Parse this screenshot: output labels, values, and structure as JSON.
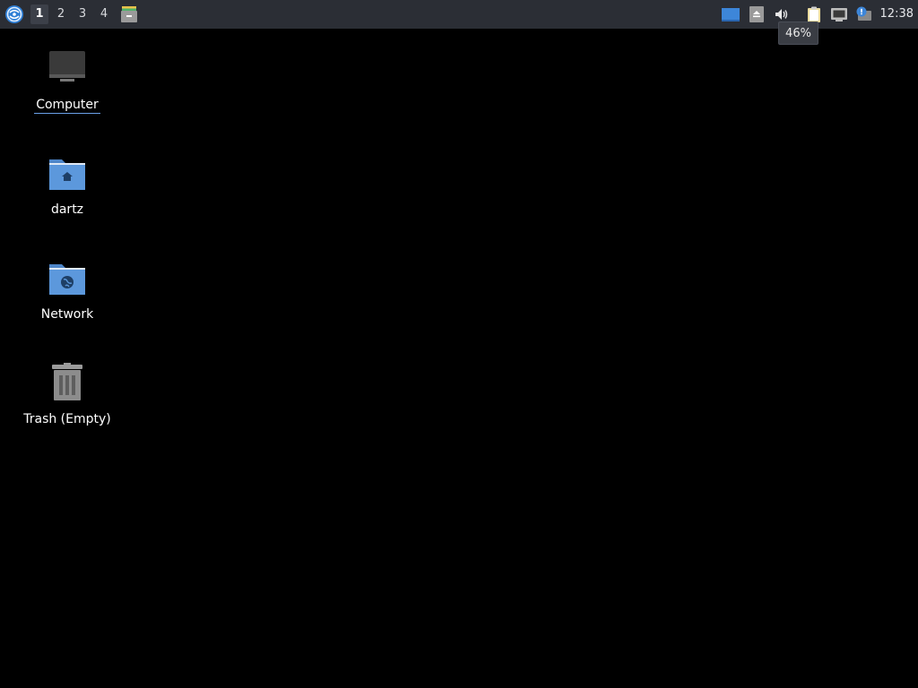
{
  "panel": {
    "workspaces": [
      {
        "label": "1",
        "active": true
      },
      {
        "label": "2",
        "active": false
      },
      {
        "label": "3",
        "active": false
      },
      {
        "label": "4",
        "active": false
      }
    ],
    "clock": "12:38",
    "volume_tooltip": "46%",
    "icons": {
      "start": "start-menu-icon",
      "task": "archive-icon",
      "desktop": "show-desktop-icon",
      "eject": "eject-icon",
      "volume": "speaker-icon",
      "clipboard": "clipboard-icon",
      "network": "network-icon",
      "updates": "updates-icon"
    }
  },
  "desktop": {
    "icons": [
      {
        "label": "Computer",
        "icon": "computer-icon"
      },
      {
        "label": "dartz",
        "icon": "home-folder-icon"
      },
      {
        "label": "Network",
        "icon": "network-folder-icon"
      },
      {
        "label": "Trash (Empty)",
        "icon": "trash-icon"
      }
    ]
  },
  "colors": {
    "panel_bg": "#2b2e35",
    "desktop_bg": "#000000",
    "folder_blue": "#5c98dc",
    "accent": "#3d86d9"
  }
}
